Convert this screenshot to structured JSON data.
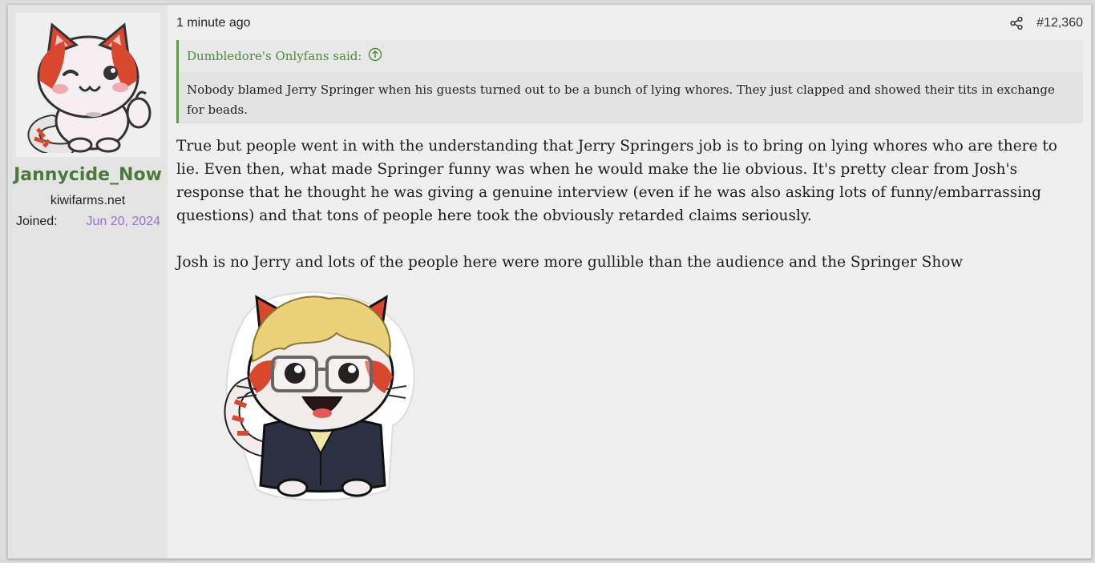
{
  "user": {
    "username": "Jannycide_Now",
    "site": "kiwifarms.net",
    "joined_label": "Joined:",
    "joined_date": "Jun 20, 2024"
  },
  "post": {
    "timestamp": "1 minute ago",
    "number": "#12,360",
    "quote": {
      "author": "Dumbledore's Onlyfans said:",
      "text": "Nobody blamed Jerry Springer when his guests turned out to be a bunch of lying whores. They just clapped and showed their tits in exchange for beads."
    },
    "paragraphs": [
      "True but people went in with the understanding that Jerry Springers job is to bring on lying whores who are there to lie. Even then, what made Springer funny was when he would make the lie obvious. It's pretty clear from Josh's response that he thought he was giving a genuine interview (even if he was also asking lots of funny/embarrassing questions) and that tons of people here took the obviously retarded claims seriously.",
      "Josh is no Jerry and lots of the people here were more gullible than the audience and the Springer Show"
    ]
  },
  "icons": {
    "share": "share-icon",
    "quote_jump": "arrow-up-circle-icon"
  },
  "colors": {
    "username": "#4c7a3c",
    "joined_date": "#9a6fd8",
    "quote_border": "#5b9c47",
    "quote_author": "#4c8a3c"
  }
}
